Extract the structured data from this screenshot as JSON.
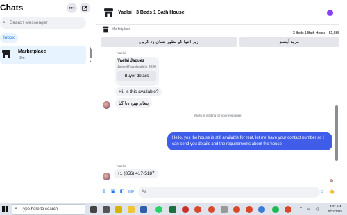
{
  "sidebar": {
    "title": "Chats",
    "more_icon": "more-horizontal-icon",
    "compose_icon": "compose-icon",
    "search_placeholder": "Search Messenger",
    "inbox_chip": "Inbox",
    "conversation": {
      "name": "Marketplace",
      "time": "3m",
      "icon": "marketplace-store-icon"
    }
  },
  "chat": {
    "title": "Yaelsi · 3 Beds 1 Bath House",
    "marketplace_label": "Marketplace",
    "listing_price": "3 Beds 1 Bath House · $1,685",
    "action_buttons": [
      "زیر التوا کے بطور نشان زد کریں",
      "مزید آپشنز"
    ],
    "messages": {
      "sender_label_1": "Yaelsi",
      "card_name": "Yaelsi Jaquez",
      "card_sub": "Joined Facebook in 2020",
      "card_button": "Buyer details",
      "msg_1": "Hi, is this available?",
      "msg_2": "پیغام بھیج دیا گیا",
      "status": "Yaelsi is waiting for your response.",
      "outgoing": "Hello, yes the house is still available for rent, let me have your contact number so I can send you details and the requirements about the house.",
      "sender_label_2": "Yaelsi",
      "msg_3": "+1 (856) 417-5187"
    },
    "composer": {
      "placeholder": "Aa",
      "icons": [
        "plus-circle-icon",
        "image-icon",
        "sticker-icon",
        "gif-icon",
        "emoji-icon",
        "thumbs-up-icon"
      ]
    }
  },
  "taskbar": {
    "search_placeholder": "Type here to search",
    "time": "3:42 AM",
    "date": "5/22/2025"
  },
  "colors": {
    "accent": "#1877f2",
    "outgoing_bubble": "#3f5de8",
    "info_icon": "#8a3ffc"
  }
}
